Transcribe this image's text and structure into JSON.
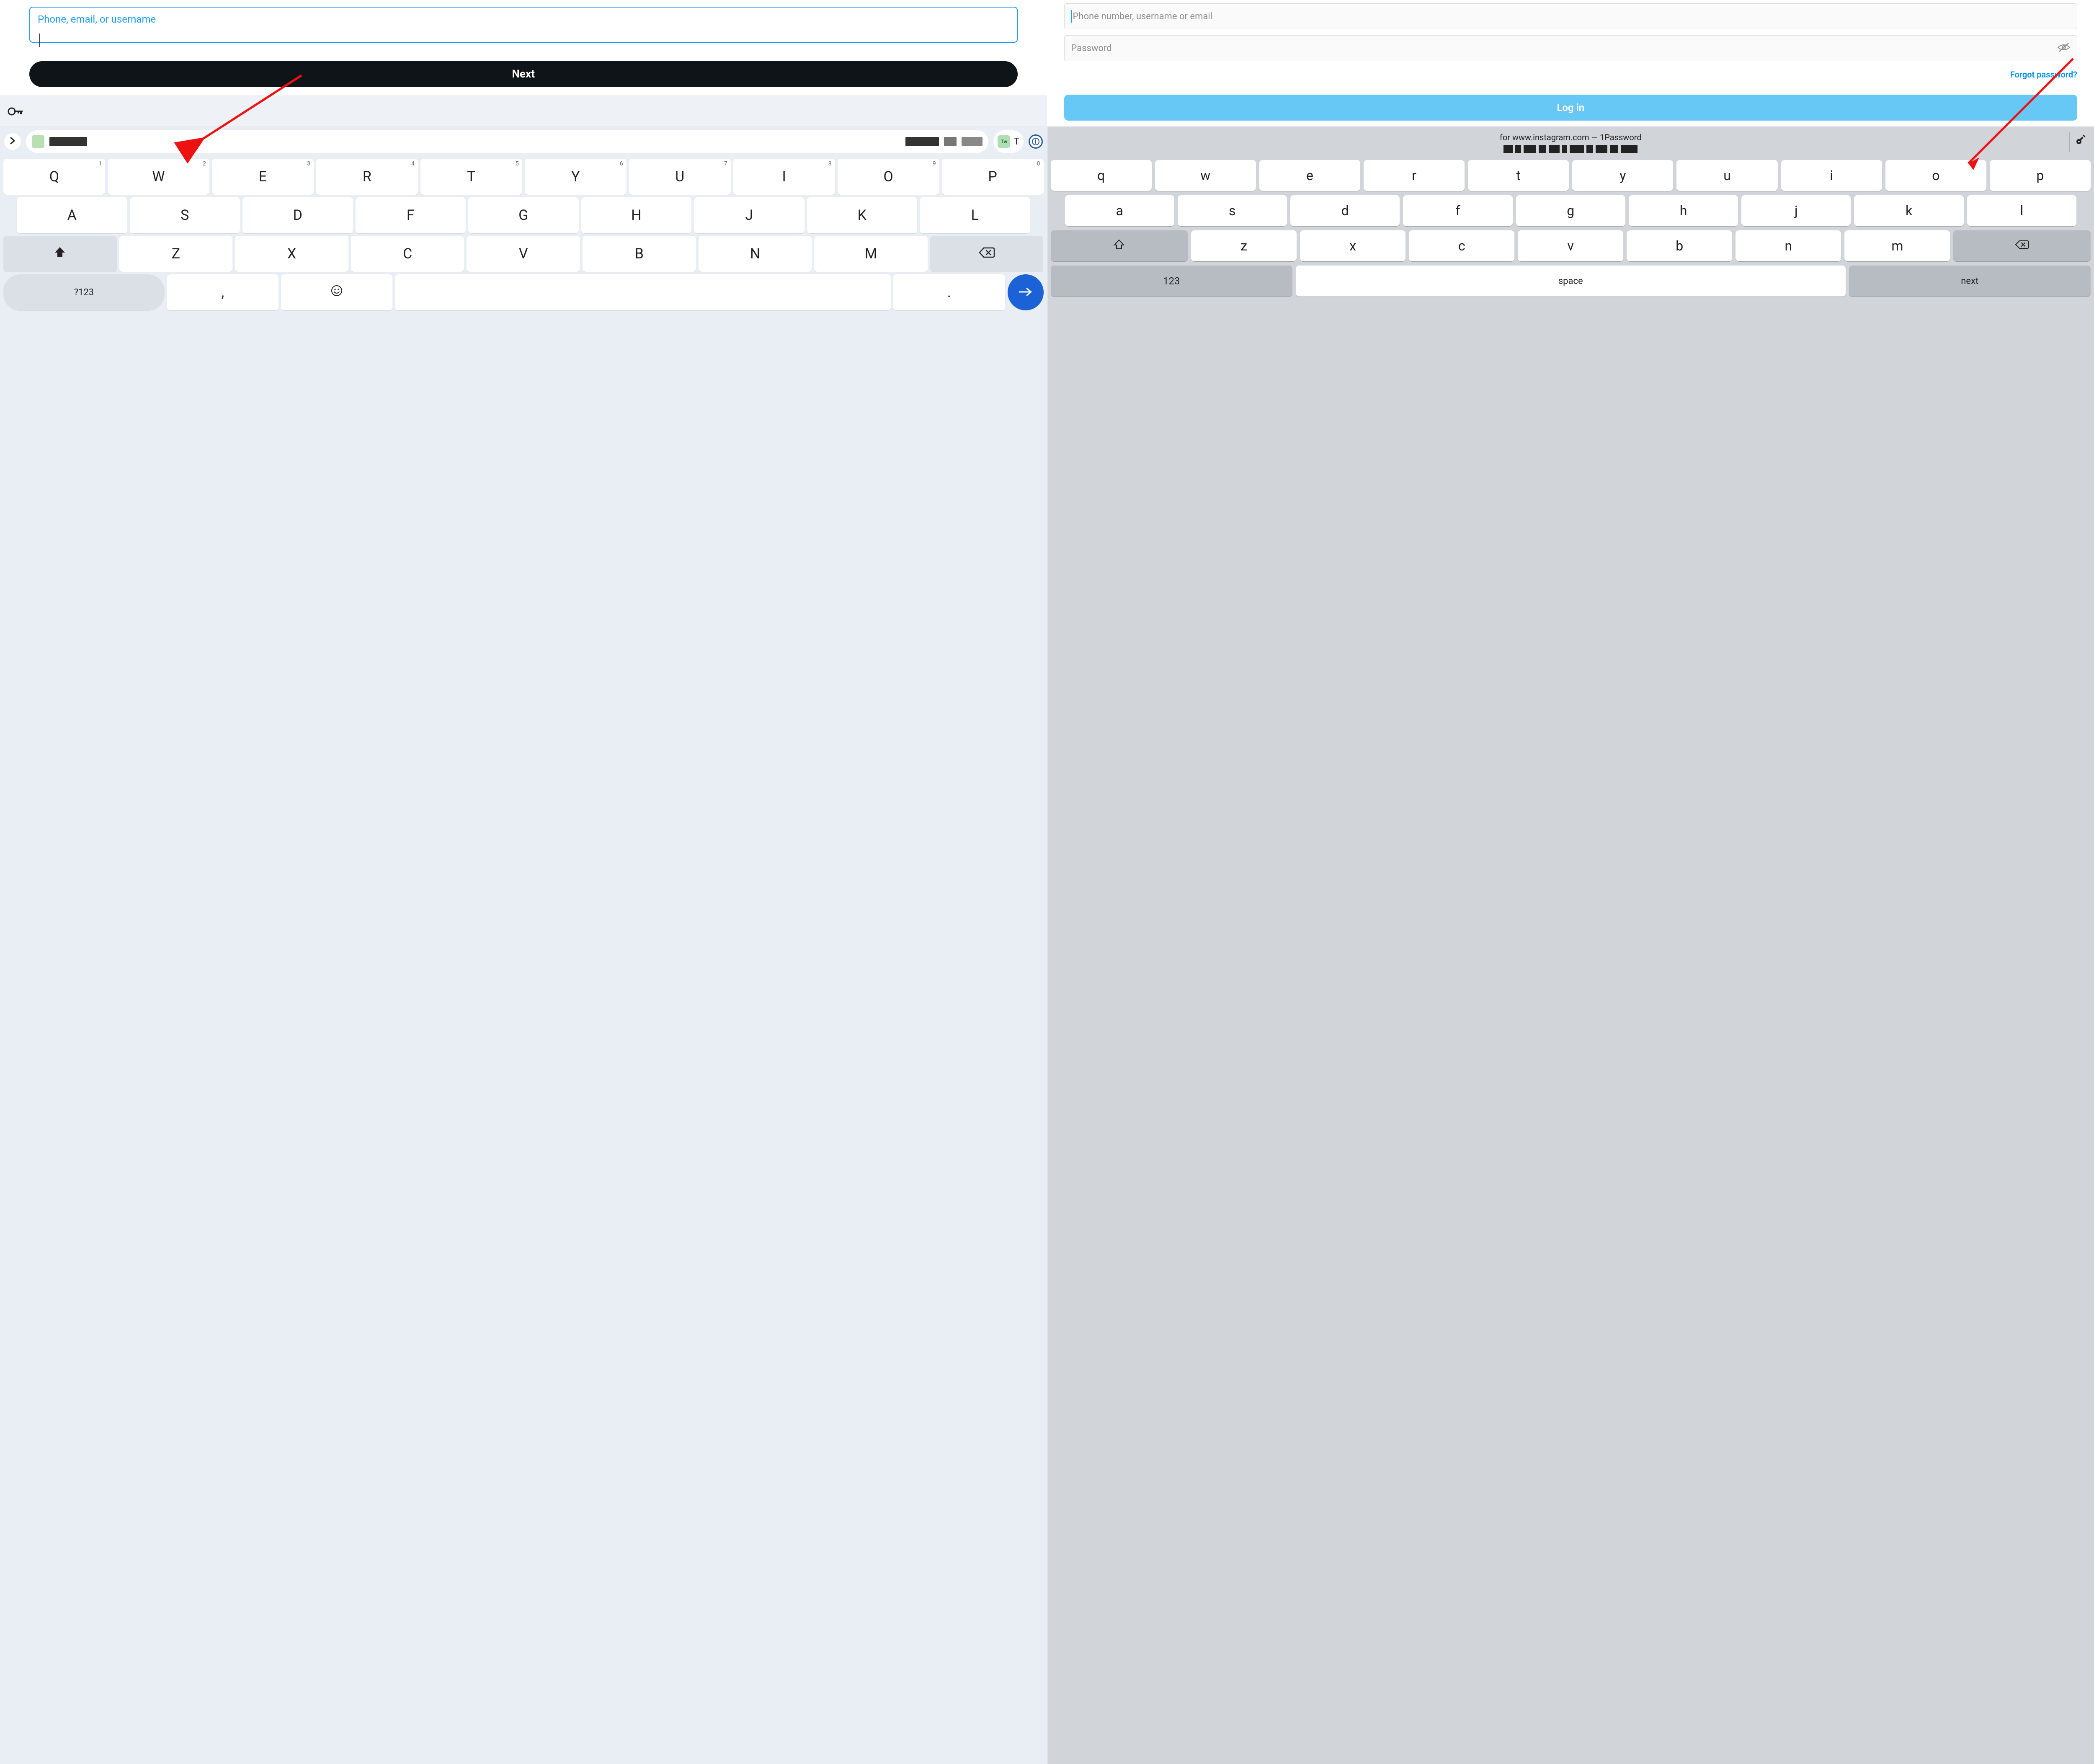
{
  "left": {
    "input_label": "Phone, email, or username",
    "next_button": "Next",
    "suggestion_chip2_label": "T",
    "tw_badge": "Tw",
    "keyboard": {
      "row1": [
        {
          "k": "Q",
          "n": "1"
        },
        {
          "k": "W",
          "n": "2"
        },
        {
          "k": "E",
          "n": "3"
        },
        {
          "k": "R",
          "n": "4"
        },
        {
          "k": "T",
          "n": "5"
        },
        {
          "k": "Y",
          "n": "6"
        },
        {
          "k": "U",
          "n": "7"
        },
        {
          "k": "I",
          "n": "8"
        },
        {
          "k": "O",
          "n": "9"
        },
        {
          "k": "P",
          "n": "0"
        }
      ],
      "row2": [
        "A",
        "S",
        "D",
        "F",
        "G",
        "H",
        "J",
        "K",
        "L"
      ],
      "row3": [
        "Z",
        "X",
        "C",
        "V",
        "B",
        "N",
        "M"
      ],
      "sym": "?123",
      "comma": ",",
      "period": "."
    }
  },
  "right": {
    "username_placeholder": "Phone number, username or email",
    "password_placeholder": "Password",
    "forgot": "Forgot password?",
    "login": "Log in",
    "suggestion_line": "for www.instagram.com — 1Password",
    "keyboard": {
      "row1": [
        "q",
        "w",
        "e",
        "r",
        "t",
        "y",
        "u",
        "i",
        "o",
        "p"
      ],
      "row2": [
        "a",
        "s",
        "d",
        "f",
        "g",
        "h",
        "j",
        "k",
        "l"
      ],
      "row3": [
        "z",
        "x",
        "c",
        "v",
        "b",
        "n",
        "m"
      ],
      "n123": "123",
      "space": "space",
      "next": "next"
    }
  }
}
